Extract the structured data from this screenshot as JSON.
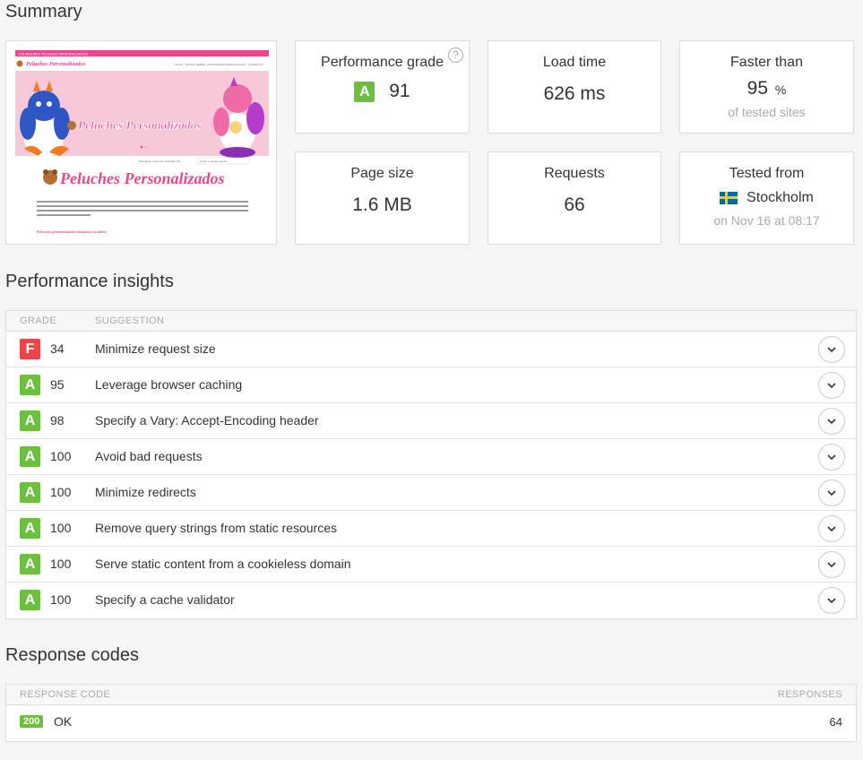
{
  "summary": {
    "title": "Summary",
    "thumbnail": {
      "top_bar_text": "LOS MEJORES PELUCHES PERSONALIZADOS",
      "logo_text": "Peluches Personalizados",
      "nav_items": [
        "INICIO",
        "BODAS",
        "BEBÉS",
        "CUMPLEAÑOS",
        "REGALO",
        "BLOG",
        "CONTACTO"
      ],
      "hero_text": "Peluches Personalizados",
      "heading_text": "Peluches Personalizados",
      "sort_label": "Mostrando todos los resultados 36",
      "sort_value": "Orden predeterminado",
      "body_text": "Nuestro objetivo es ofrecer regalos totalmente exclusivos por ello, todos nuestros peluches personalizados son únicos, siendo a nuestros clientes un servicio especial y todos los niveles. Los peluches personalizados que encontrarás en nuestra web, están confeccionados con materiales de primera calidad.",
      "footer_text": "Peluches personalizados exclusivos & ositos"
    },
    "cards": {
      "grade": {
        "label": "Performance grade",
        "letter": "A",
        "score": "91",
        "help": "?"
      },
      "load_time": {
        "label": "Load time",
        "value": "626 ms"
      },
      "faster": {
        "label": "Faster than",
        "value": "95",
        "unit": "%",
        "sub": "of tested sites"
      },
      "page_size": {
        "label": "Page size",
        "value": "1.6 MB"
      },
      "requests": {
        "label": "Requests",
        "value": "66"
      },
      "tested": {
        "label": "Tested from",
        "city": "Stockholm",
        "sub": "on Nov 16 at 08:17"
      }
    }
  },
  "insights": {
    "title": "Performance insights",
    "headers": {
      "grade": "GRADE",
      "suggestion": "SUGGESTION"
    },
    "rows": [
      {
        "grade": "F",
        "score": "34",
        "text": "Minimize request size"
      },
      {
        "grade": "A",
        "score": "95",
        "text": "Leverage browser caching"
      },
      {
        "grade": "A",
        "score": "98",
        "text": "Specify a Vary: Accept-Encoding header"
      },
      {
        "grade": "A",
        "score": "100",
        "text": "Avoid bad requests"
      },
      {
        "grade": "A",
        "score": "100",
        "text": "Minimize redirects"
      },
      {
        "grade": "A",
        "score": "100",
        "text": "Remove query strings from static resources"
      },
      {
        "grade": "A",
        "score": "100",
        "text": "Serve static content from a cookieless domain"
      },
      {
        "grade": "A",
        "score": "100",
        "text": "Specify a cache validator"
      }
    ]
  },
  "response_codes": {
    "title": "Response codes",
    "headers": {
      "code": "RESPONSE CODE",
      "responses": "RESPONSES"
    },
    "rows": [
      {
        "code": "200",
        "text": "OK",
        "count": "64"
      }
    ]
  },
  "colors": {
    "grade_a": "#6cbf3f",
    "grade_f": "#e8464a",
    "thumb_pink": "#e8478b"
  }
}
